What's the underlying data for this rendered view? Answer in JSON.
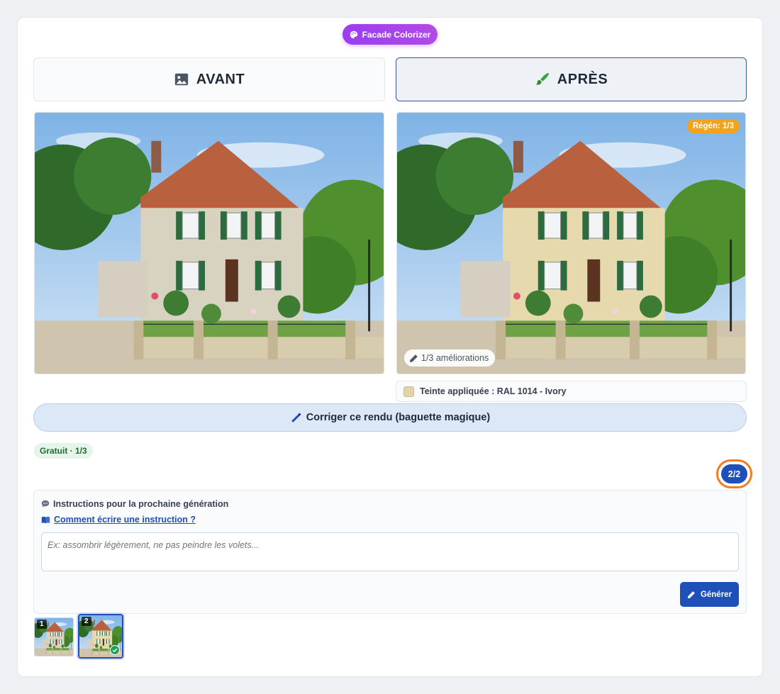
{
  "app": {
    "brand_label": "Facade Colorizer",
    "brand_icon": "palette-icon",
    "accent": "#9b3df0"
  },
  "tabs": {
    "before": {
      "label": "AVANT",
      "icon": "image-icon"
    },
    "after": {
      "label": "APRÈS",
      "icon": "paintbrush-icon"
    }
  },
  "after_panel": {
    "regen_badge": "Régén: 1/3",
    "improvements_chip": "1/3 améliorations",
    "tint_label": "Teinte appliquée : RAL 1014 - Ivory",
    "tint_color": "#e3d4a8"
  },
  "fix_button": {
    "label": "Corriger ce rendu (baguette magique)",
    "icon": "magic-wand-icon"
  },
  "quota": {
    "free_label": "Gratuit · 1/3",
    "counter": "2/2"
  },
  "instructions": {
    "title": "Instructions pour la prochaine génération",
    "help_link": "Comment écrire une instruction ?",
    "placeholder": "Ex: assombrir légèrement, ne pas peindre les volets...",
    "generate_label": "Générer"
  },
  "history": [
    {
      "number": "1",
      "selected": false
    },
    {
      "number": "2",
      "selected": true
    }
  ]
}
